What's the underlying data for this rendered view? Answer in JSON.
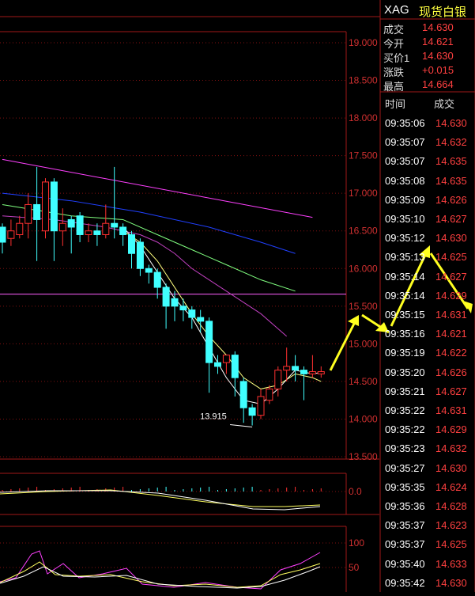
{
  "quote": {
    "symbol": "XAG",
    "name": "现货白银",
    "rows": [
      {
        "label": "成交",
        "value": "14.630",
        "color": "#ff4040"
      },
      {
        "label": "今开",
        "value": "14.621",
        "color": "#ff4040"
      },
      {
        "label": "买价1",
        "value": "14.630",
        "color": "#ff4040"
      },
      {
        "label": "涨跌",
        "value": "+0.015",
        "color": "#ff4040"
      },
      {
        "label": "最高",
        "value": "14.664",
        "color": "#ff4040"
      }
    ]
  },
  "trades": {
    "header_time": "时间",
    "header_price": "成交",
    "rows": [
      {
        "time": "09:35:06",
        "price": "14.630"
      },
      {
        "time": "09:35:07",
        "price": "14.632"
      },
      {
        "time": "09:35:07",
        "price": "14.635"
      },
      {
        "time": "09:35:08",
        "price": "14.635"
      },
      {
        "time": "09:35:09",
        "price": "14.626"
      },
      {
        "time": "09:35:10",
        "price": "14.627"
      },
      {
        "time": "09:35:12",
        "price": "14.630"
      },
      {
        "time": "09:35:13",
        "price": "14.625"
      },
      {
        "time": "09:35:14",
        "price": "14.627"
      },
      {
        "time": "09:35:14",
        "price": "14.629"
      },
      {
        "time": "09:35:15",
        "price": "14.631"
      },
      {
        "time": "09:35:16",
        "price": "14.621"
      },
      {
        "time": "09:35:19",
        "price": "14.622"
      },
      {
        "time": "09:35:20",
        "price": "14.626"
      },
      {
        "time": "09:35:21",
        "price": "14.627"
      },
      {
        "time": "09:35:22",
        "price": "14.631"
      },
      {
        "time": "09:35:22",
        "price": "14.629"
      },
      {
        "time": "09:35:23",
        "price": "14.632"
      },
      {
        "time": "09:35:27",
        "price": "14.630"
      },
      {
        "time": "09:35:35",
        "price": "14.624"
      },
      {
        "time": "09:35:36",
        "price": "14.628"
      },
      {
        "time": "09:35:37",
        "price": "14.623"
      },
      {
        "time": "09:35:37",
        "price": "14.625"
      },
      {
        "time": "09:35:40",
        "price": "14.633"
      },
      {
        "time": "09:35:42",
        "price": "14.630"
      }
    ]
  },
  "chart_data": {
    "type": "candlestick",
    "ylim": [
      13.5,
      19.2
    ],
    "yticks": [
      "19.000",
      "18.500",
      "18.000",
      "17.500",
      "17.000",
      "16.500",
      "16.000",
      "15.500",
      "15.000",
      "14.500",
      "14.000",
      "13.500"
    ],
    "ytick_values": [
      19.0,
      18.5,
      18.0,
      17.5,
      17.0,
      16.5,
      16.0,
      15.5,
      15.0,
      14.5,
      14.0,
      13.5
    ],
    "low_annotation": "13.915",
    "low_value": 13.915,
    "horizontal_level": 15.66,
    "candles": [
      {
        "o": 16.55,
        "c": 16.35,
        "h": 16.6,
        "l": 16.2
      },
      {
        "o": 16.4,
        "c": 16.5,
        "h": 16.65,
        "l": 16.3
      },
      {
        "o": 16.45,
        "c": 16.6,
        "h": 16.7,
        "l": 16.4
      },
      {
        "o": 16.6,
        "c": 16.85,
        "h": 17.0,
        "l": 16.4
      },
      {
        "o": 16.85,
        "c": 16.65,
        "h": 17.35,
        "l": 16.1
      },
      {
        "o": 16.5,
        "c": 17.15,
        "h": 17.2,
        "l": 16.4
      },
      {
        "o": 17.15,
        "c": 16.5,
        "h": 17.2,
        "l": 16.1
      },
      {
        "o": 16.5,
        "c": 16.6,
        "h": 16.8,
        "l": 16.3
      },
      {
        "o": 16.65,
        "c": 16.55,
        "h": 16.7,
        "l": 16.2
      },
      {
        "o": 16.7,
        "c": 16.45,
        "h": 16.75,
        "l": 16.35
      },
      {
        "o": 16.45,
        "c": 16.5,
        "h": 16.6,
        "l": 16.35
      },
      {
        "o": 16.5,
        "c": 16.45,
        "h": 16.6,
        "l": 16.3
      },
      {
        "o": 16.45,
        "c": 16.6,
        "h": 16.85,
        "l": 16.4
      },
      {
        "o": 16.6,
        "c": 16.55,
        "h": 17.35,
        "l": 16.4
      },
      {
        "o": 16.55,
        "c": 16.45,
        "h": 16.6,
        "l": 16.3
      },
      {
        "o": 16.45,
        "c": 16.2,
        "h": 16.5,
        "l": 16.0
      },
      {
        "o": 16.35,
        "c": 16.0,
        "h": 16.4,
        "l": 15.9
      },
      {
        "o": 16.0,
        "c": 15.95,
        "h": 16.05,
        "l": 15.8
      },
      {
        "o": 15.95,
        "c": 15.75,
        "h": 16.0,
        "l": 15.6
      },
      {
        "o": 15.75,
        "c": 15.5,
        "h": 15.8,
        "l": 15.2
      },
      {
        "o": 15.6,
        "c": 15.5,
        "h": 15.7,
        "l": 15.3
      },
      {
        "o": 15.5,
        "c": 15.45,
        "h": 15.6,
        "l": 15.3
      },
      {
        "o": 15.45,
        "c": 15.35,
        "h": 15.5,
        "l": 15.2
      },
      {
        "o": 15.35,
        "c": 15.3,
        "h": 15.45,
        "l": 15.15
      },
      {
        "o": 15.3,
        "c": 14.75,
        "h": 15.35,
        "l": 14.35
      },
      {
        "o": 14.75,
        "c": 14.7,
        "h": 14.85,
        "l": 14.6
      },
      {
        "o": 14.75,
        "c": 14.85,
        "h": 14.85,
        "l": 14.6
      },
      {
        "o": 14.85,
        "c": 14.55,
        "h": 14.9,
        "l": 14.3
      },
      {
        "o": 14.5,
        "c": 14.15,
        "h": 14.55,
        "l": 13.95
      },
      {
        "o": 14.15,
        "c": 14.05,
        "h": 14.2,
        "l": 13.915
      },
      {
        "o": 14.05,
        "c": 14.3,
        "h": 14.4,
        "l": 14.0
      },
      {
        "o": 14.25,
        "c": 14.4,
        "h": 14.45,
        "l": 14.2
      },
      {
        "o": 14.4,
        "c": 14.65,
        "h": 14.7,
        "l": 14.3
      },
      {
        "o": 14.65,
        "c": 14.7,
        "h": 14.95,
        "l": 14.5
      },
      {
        "o": 14.7,
        "c": 14.65,
        "h": 14.85,
        "l": 14.5
      },
      {
        "o": 14.65,
        "c": 14.6,
        "h": 14.7,
        "l": 14.25
      },
      {
        "o": 14.6,
        "c": 14.63,
        "h": 14.85,
        "l": 14.55
      },
      {
        "o": 14.6,
        "c": 14.63,
        "h": 14.7,
        "l": 14.55
      }
    ],
    "ma_lines": [
      {
        "color": "#ff40ff",
        "values": [
          [
            0,
            17.45
          ],
          [
            36,
            16.68
          ]
        ]
      },
      {
        "color": "#2040ff",
        "values": [
          [
            0,
            17.0
          ],
          [
            8,
            16.9
          ],
          [
            16,
            16.75
          ],
          [
            24,
            16.55
          ],
          [
            30,
            16.35
          ],
          [
            34,
            16.2
          ]
        ]
      },
      {
        "color": "#80ff80",
        "values": [
          [
            0,
            16.85
          ],
          [
            8,
            16.7
          ],
          [
            14,
            16.65
          ],
          [
            18,
            16.45
          ],
          [
            22,
            16.25
          ],
          [
            26,
            16.05
          ],
          [
            30,
            15.85
          ],
          [
            34,
            15.7
          ]
        ]
      },
      {
        "color": "#c040c0",
        "values": [
          [
            0,
            16.7
          ],
          [
            6,
            16.65
          ],
          [
            12,
            16.55
          ],
          [
            16,
            16.45
          ],
          [
            18,
            16.35
          ],
          [
            20,
            16.2
          ],
          [
            22,
            16.0
          ],
          [
            24,
            15.85
          ],
          [
            26,
            15.7
          ],
          [
            28,
            15.55
          ],
          [
            30,
            15.4
          ],
          [
            33,
            15.1
          ]
        ]
      },
      {
        "color": "#ffff80",
        "values": [
          [
            14,
            16.5
          ],
          [
            16,
            16.35
          ],
          [
            18,
            16.1
          ],
          [
            20,
            15.75
          ],
          [
            22,
            15.4
          ],
          [
            24,
            15.1
          ],
          [
            26,
            14.85
          ],
          [
            28,
            14.55
          ],
          [
            30,
            14.4
          ],
          [
            32,
            14.45
          ],
          [
            34,
            14.6
          ],
          [
            36,
            14.55
          ],
          [
            37,
            14.5
          ]
        ]
      },
      {
        "color": "#ffffff",
        "values": [
          [
            14,
            16.55
          ],
          [
            16,
            16.3
          ],
          [
            18,
            15.95
          ],
          [
            20,
            15.6
          ],
          [
            22,
            15.35
          ],
          [
            24,
            14.95
          ],
          [
            26,
            14.55
          ],
          [
            28,
            14.25
          ],
          [
            30,
            14.2
          ],
          [
            32,
            14.4
          ],
          [
            34,
            14.65
          ],
          [
            36,
            14.6
          ],
          [
            37,
            14.62
          ]
        ]
      }
    ],
    "macd_axis_label": "0.0",
    "kdj_axis_labels": [
      "100",
      "50"
    ]
  },
  "colors": {
    "up": "#ff3030",
    "down": "#40ffff",
    "grid": "#801010",
    "axis_text": "#d03030",
    "arrow": "#ffff20"
  }
}
